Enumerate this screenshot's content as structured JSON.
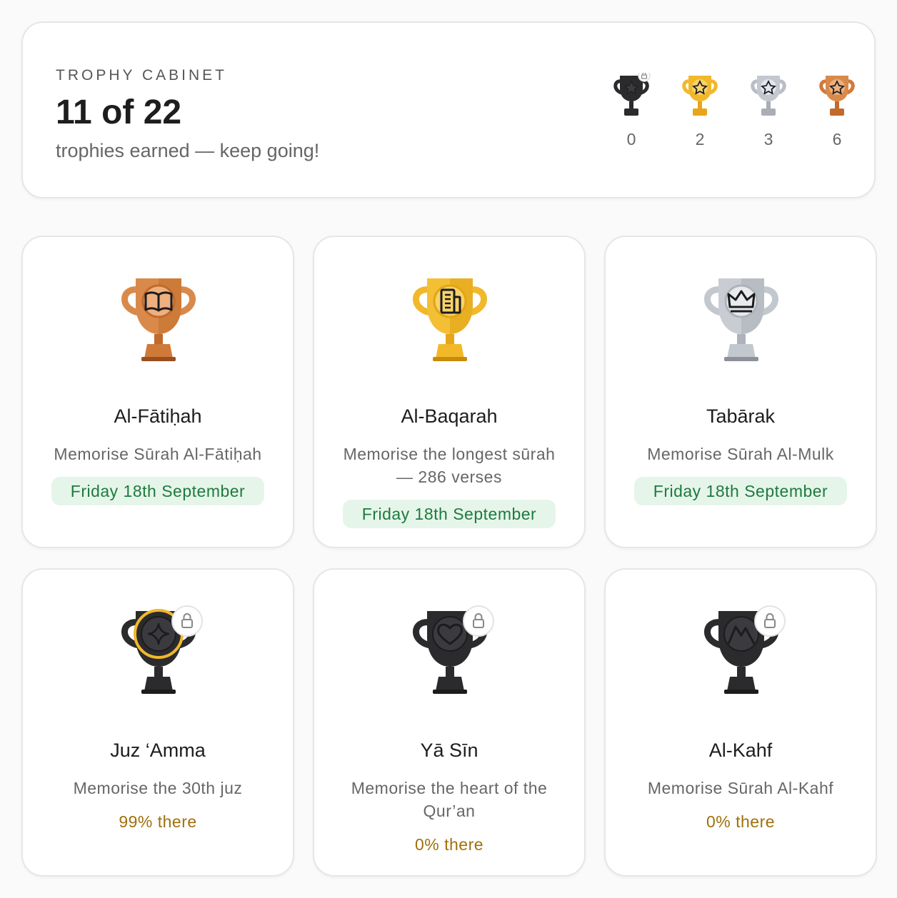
{
  "summary": {
    "kicker": "TROPHY CABINET",
    "count": "11 of 22",
    "subtitle": "trophies earned — keep going!",
    "tiers": [
      {
        "name": "locked",
        "count": "0",
        "color": "#2b2b2e"
      },
      {
        "name": "gold",
        "count": "2",
        "color": "#f1b82a"
      },
      {
        "name": "silver",
        "count": "3",
        "color": "#b9bec6"
      },
      {
        "name": "bronze",
        "count": "6",
        "color": "#d07a3a"
      }
    ]
  },
  "cards": [
    {
      "title": "Al-Fātiḥah",
      "description": "Memorise Sūrah Al-Fātiḥah",
      "status": "Friday 18th September",
      "tier": "bronze",
      "icon": "book-icon",
      "locked": false
    },
    {
      "title": "Al-Baqarah",
      "description": "Memorise the longest sūrah — 286 verses",
      "status": "Friday 18th September",
      "tier": "gold",
      "icon": "building-icon",
      "locked": false
    },
    {
      "title": "Tabārak",
      "description": "Memorise Sūrah Al-Mulk",
      "status": "Friday 18th September",
      "tier": "silver",
      "icon": "crown-icon",
      "locked": false
    },
    {
      "title": "Juz ‘Amma",
      "description": "Memorise the 30th juz",
      "status": "99% there",
      "progress": 0.99,
      "tier": "locked",
      "icon": "sparkle-icon",
      "locked": true
    },
    {
      "title": "Yā Sīn",
      "description": "Memorise the heart of the Qur’an",
      "status": "0% there",
      "progress": 0,
      "tier": "locked",
      "icon": "heart-icon",
      "locked": true
    },
    {
      "title": "Al-Kahf",
      "description": "Memorise Sūrah Al-Kahf",
      "status": "0% there",
      "progress": 0,
      "tier": "locked",
      "icon": "mountain-icon",
      "locked": true
    }
  ]
}
